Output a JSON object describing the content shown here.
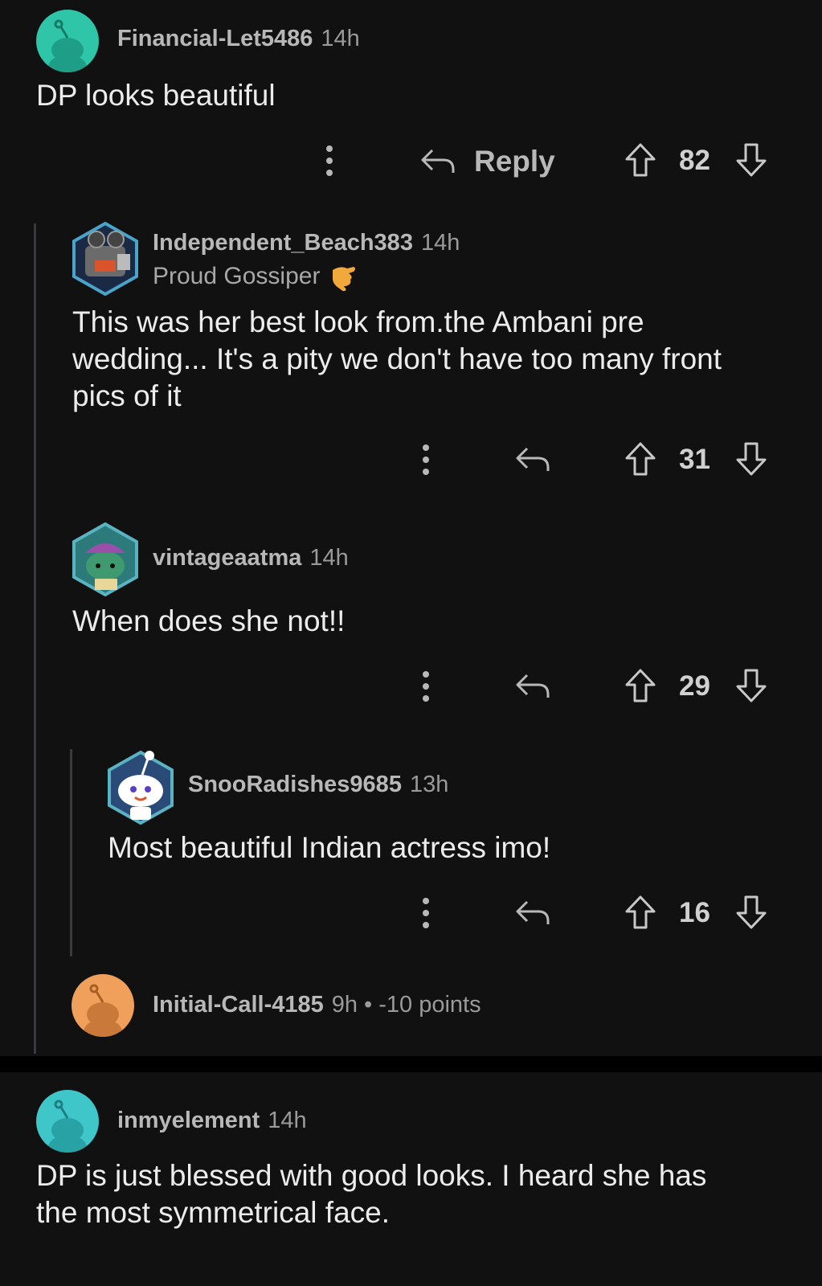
{
  "comments": [
    {
      "user": "Financial-Let5486",
      "time": "14h",
      "body": "DP looks beautiful",
      "reply_label": "Reply",
      "votes": "82",
      "avatar_color": "#2ec5a8"
    },
    {
      "user": "Independent_Beach383",
      "time": "14h",
      "flair": "Proud Gossiper",
      "body_lines": [
        "This was her best look from.the Ambani pre",
        "wedding... It's a pity we don't have too many front",
        "pics of it"
      ],
      "votes": "31"
    },
    {
      "user": "vintageaatma",
      "time": "14h",
      "body": "When does she not!!",
      "votes": "29"
    },
    {
      "user": "SnooRadishes9685",
      "time": "13h",
      "body": "Most beautiful Indian actress imo!",
      "votes": "16"
    },
    {
      "user": "Initial-Call-4185",
      "time": "9h",
      "score": "• -10 points",
      "avatar_color": "#f0a05a"
    },
    {
      "user": "inmyelement",
      "time": "14h",
      "body_lines": [
        "DP is just blessed with good looks. I heard she has",
        "the most symmetrical face."
      ],
      "avatar_color": "#3fc6c9"
    }
  ],
  "colors": {
    "background": "#111112",
    "text": "#ececec",
    "muted": "#9a9a9a",
    "thread_line": "#3a3a3c",
    "flair_emoji": "#f2a93b"
  }
}
